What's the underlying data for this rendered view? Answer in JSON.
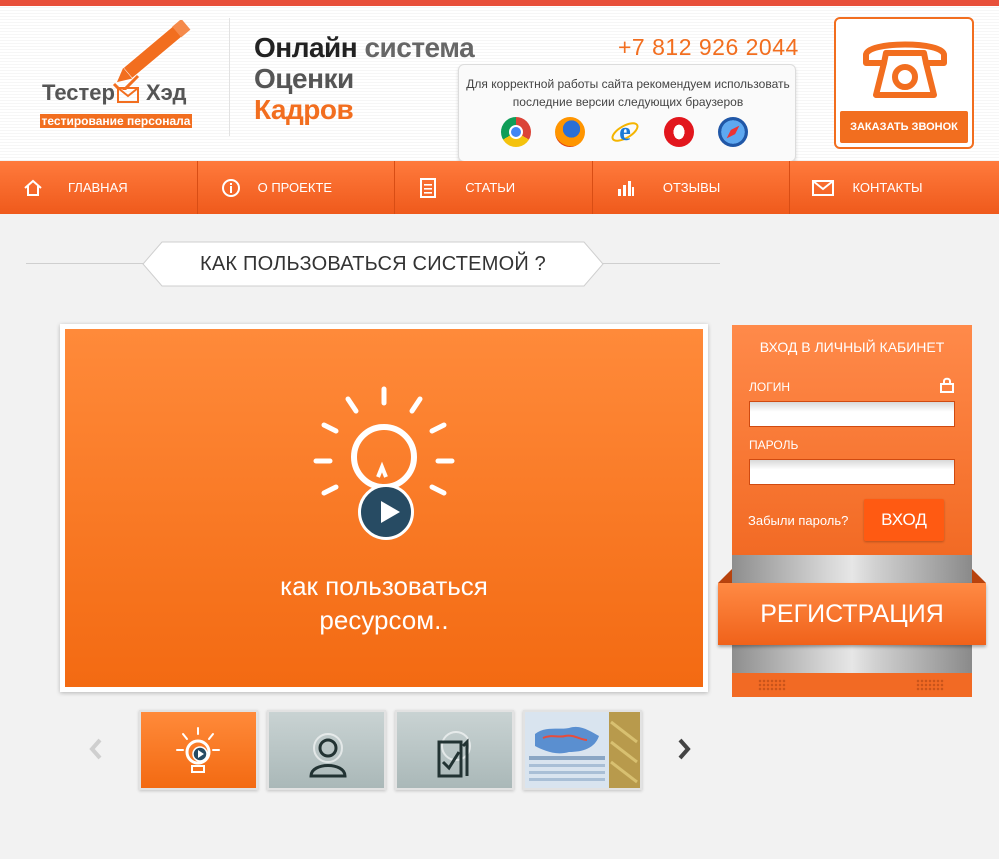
{
  "logo": {
    "name_left": "Тестер",
    "name_right": "Хэд",
    "tagline": "тестирование персонала"
  },
  "slogan": {
    "line1_bold": "Онлайн",
    "line1_rest": "система",
    "line2": "Оценки",
    "line3": "Кадров"
  },
  "phone": "+7 812 926 2044",
  "browsers": {
    "note": "Для корректной работы сайта рекомендуем использовать последние версии следующих браузеров",
    "icons": [
      "chrome-icon",
      "firefox-icon",
      "ie-icon",
      "opera-icon",
      "safari-icon"
    ]
  },
  "callback": {
    "button_label": "ЗАКАЗАТЬ ЗВОНОК",
    "icon": "telephone-icon"
  },
  "nav": {
    "items": [
      {
        "label": "ГЛАВНАЯ",
        "icon": "home-icon"
      },
      {
        "label": "О ПРОЕКТЕ",
        "icon": "info-icon"
      },
      {
        "label": "СТАТЬИ",
        "icon": "document-icon"
      },
      {
        "label": "ОТЗЫВЫ",
        "icon": "bar-chart-icon"
      },
      {
        "label": "КОНТАКТЫ",
        "icon": "envelope-icon"
      }
    ]
  },
  "section": {
    "title": "КАК ПОЛЬЗОВАТЬСЯ СИСТЕМОЙ ?"
  },
  "video": {
    "caption_line1": "как пользоваться",
    "caption_line2": "ресурсом..",
    "icon": "lightbulb-icon"
  },
  "thumbs": [
    {
      "icon": "lightbulb-icon"
    },
    {
      "icon": "user-icon"
    },
    {
      "icon": "checklist-icon"
    },
    {
      "icon": "map-screenshot"
    }
  ],
  "login": {
    "title": "ВХОД В ЛИЧНЫЙ КАБИНЕТ",
    "login_label": "ЛОГИН",
    "password_label": "ПАРОЛЬ",
    "login_value": "",
    "password_value": "",
    "forgot": "Забыли пароль?",
    "enter": "ВХОД",
    "register": "РЕГИСТРАЦИЯ"
  },
  "colors": {
    "accent": "#f26e1f",
    "nav": "#ef5a1c",
    "video_blue": "#274b63"
  }
}
